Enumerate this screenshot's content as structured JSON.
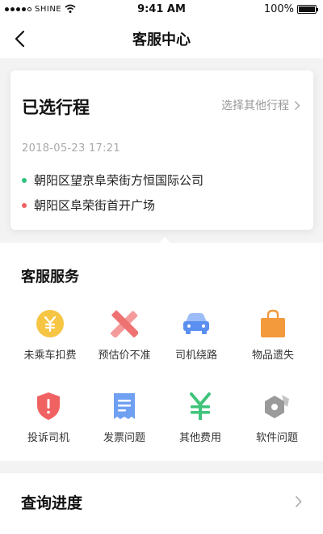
{
  "status_bar": {
    "carrier": "SHINE",
    "time": "9:41 AM",
    "battery": "100%",
    "battery_level": 1.0
  },
  "nav": {
    "title": "客服中心",
    "back_icon": "chevron-left-icon"
  },
  "trip": {
    "title": "已选行程",
    "other_label": "选择其他行程",
    "datetime": "2018-05-23   17:21",
    "start_address": "朝阳区望京阜荣街方恒国际公司",
    "end_address": "朝阳区阜荣街首开广场",
    "colors": {
      "start": "#2ec27e",
      "end": "#f06262"
    }
  },
  "services": {
    "title": "客服服务",
    "items": [
      {
        "label": "未乘车扣费",
        "icon": "yen-coin-icon",
        "color": "#f7c544"
      },
      {
        "label": "预估价不准",
        "icon": "cross-mark-icon",
        "color": "#f08a8a"
      },
      {
        "label": "司机绕路",
        "icon": "car-icon",
        "color": "#5b8ff0"
      },
      {
        "label": "物品遗失",
        "icon": "shopping-bag-icon",
        "color": "#f29a3c"
      },
      {
        "label": "投诉司机",
        "icon": "shield-alert-icon",
        "color": "#f06262"
      },
      {
        "label": "发票问题",
        "icon": "receipt-icon",
        "color": "#6fa0f2"
      },
      {
        "label": "其他费用",
        "icon": "yen-icon",
        "color": "#3fc47a"
      },
      {
        "label": "软件问题",
        "icon": "gear-hex-icon",
        "color": "#9a9a9a"
      }
    ]
  },
  "progress": {
    "title": "查询进度"
  }
}
